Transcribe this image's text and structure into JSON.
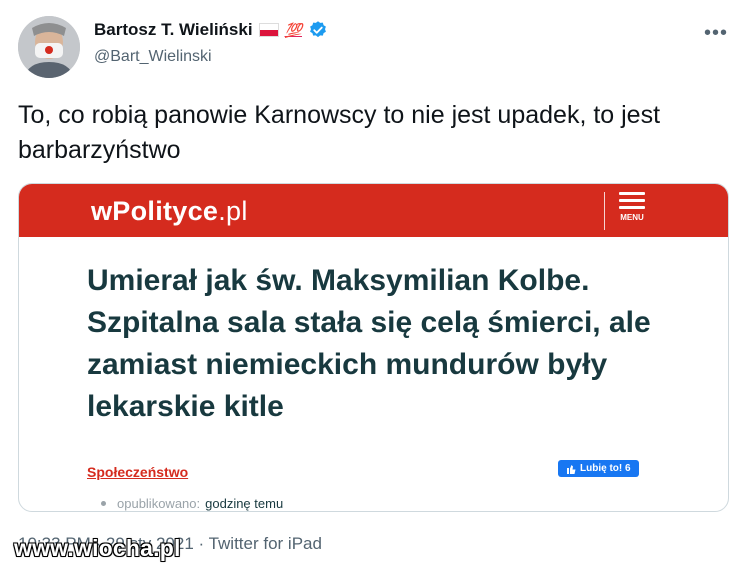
{
  "author": {
    "display_name": "Bartosz T. Wieliński",
    "emoji_badge": "💯",
    "handle": "@Bart_Wielinski"
  },
  "tweet": {
    "text": "To, co robią panowie Karnowscy to nie jest upadek, to jest barbarzyństwo"
  },
  "card": {
    "site_logo": "wPolityce",
    "site_logo_suffix": ".pl",
    "menu_label": "MENU",
    "headline": "Umierał jak św. Maksymilian Kolbe. Szpitalna sala stała się celą śmierci, ale zamiast niemieckich mundurów były lekarskie kitle",
    "category": "Społeczeństwo",
    "like_label": "Lubię to! 6",
    "published_label": "opublikowano:",
    "published_value": "godzinę temu"
  },
  "meta": {
    "timestamp_source": "10:33 PM · 29 sty 2021 · Twitter for iPad"
  },
  "watermark": "www.wiocha.pl",
  "colors": {
    "brand_red": "#d52b1e",
    "headline": "#18393f",
    "verified_blue": "#1d9bf0",
    "facebook_blue": "#1877f2"
  }
}
